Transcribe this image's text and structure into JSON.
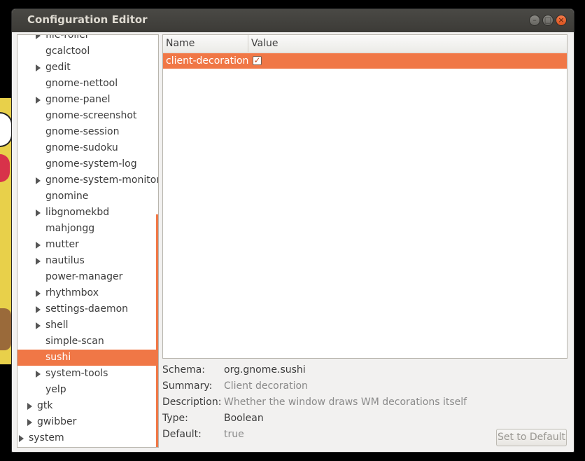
{
  "window": {
    "title": "Configuration Editor",
    "controls": {
      "minimize": "–",
      "maximize": "□",
      "close": "×"
    }
  },
  "tree": {
    "items": [
      {
        "label": "file-roller",
        "expander": true,
        "depth": 1
      },
      {
        "label": "gcalctool",
        "expander": false,
        "depth": 1
      },
      {
        "label": "gedit",
        "expander": true,
        "depth": 1
      },
      {
        "label": "gnome-nettool",
        "expander": false,
        "depth": 1
      },
      {
        "label": "gnome-panel",
        "expander": true,
        "depth": 1
      },
      {
        "label": "gnome-screenshot",
        "expander": false,
        "depth": 1
      },
      {
        "label": "gnome-session",
        "expander": false,
        "depth": 1
      },
      {
        "label": "gnome-sudoku",
        "expander": false,
        "depth": 1
      },
      {
        "label": "gnome-system-log",
        "expander": false,
        "depth": 1
      },
      {
        "label": "gnome-system-monitor",
        "expander": true,
        "depth": 1
      },
      {
        "label": "gnomine",
        "expander": false,
        "depth": 1
      },
      {
        "label": "libgnomekbd",
        "expander": true,
        "depth": 1
      },
      {
        "label": "mahjongg",
        "expander": false,
        "depth": 1
      },
      {
        "label": "mutter",
        "expander": true,
        "depth": 1
      },
      {
        "label": "nautilus",
        "expander": true,
        "depth": 1
      },
      {
        "label": "power-manager",
        "expander": false,
        "depth": 1
      },
      {
        "label": "rhythmbox",
        "expander": true,
        "depth": 1
      },
      {
        "label": "settings-daemon",
        "expander": true,
        "depth": 1
      },
      {
        "label": "shell",
        "expander": true,
        "depth": 1
      },
      {
        "label": "simple-scan",
        "expander": false,
        "depth": 1
      },
      {
        "label": "sushi",
        "expander": false,
        "depth": 1,
        "selected": true
      },
      {
        "label": "system-tools",
        "expander": true,
        "depth": 1
      },
      {
        "label": "yelp",
        "expander": false,
        "depth": 1
      },
      {
        "label": "gtk",
        "expander": true,
        "depth": 0
      },
      {
        "label": "gwibber",
        "expander": true,
        "depth": 0
      },
      {
        "label": "system",
        "expander": true,
        "depth": -1
      }
    ]
  },
  "table": {
    "columns": {
      "name": "Name",
      "value": "Value"
    },
    "rows": [
      {
        "name": "client-decoration",
        "value": true,
        "check": "✓"
      }
    ]
  },
  "details": {
    "schema_label": "Schema:",
    "schema_value": "org.gnome.sushi",
    "summary_label": "Summary:",
    "summary_value": "Client decoration",
    "description_label": "Description:",
    "description_value": "Whether the window draws WM decorations itself",
    "type_label": "Type:",
    "type_value": "Boolean",
    "default_label": "Default:",
    "default_value": "true"
  },
  "buttons": {
    "set_default": "Set to Default"
  },
  "colors": {
    "accent": "#f07746",
    "titlebar": "#3c3b37"
  }
}
